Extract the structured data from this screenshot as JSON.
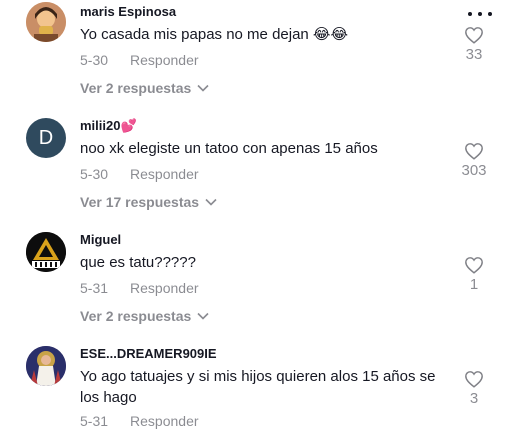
{
  "comments": [
    {
      "username": "maris Espinosa",
      "text": "Yo casada mis papas no me dejan 😂😂",
      "date": "5-30",
      "reply_label": "Responder",
      "likes": "33",
      "view_replies": "Ver 2 respuestas"
    },
    {
      "username": "milii20",
      "username_emoji": "💕",
      "avatar_letter": "D",
      "text": "noo xk elegiste un tatoo con apenas 15 años",
      "date": "5-30",
      "reply_label": "Responder",
      "likes": "303",
      "view_replies": "Ver 17 respuestas"
    },
    {
      "username": "Miguel",
      "text": "que es tatu?????",
      "date": "5-31",
      "reply_label": "Responder",
      "likes": "1",
      "view_replies": "Ver 2 respuestas"
    },
    {
      "username": "ESE...DREAMER909IE",
      "text": "Yo ago tatuajes y si mis hijos quieren alos 15 años se los hago",
      "date": "5-31",
      "reply_label": "Responder",
      "likes": "3"
    }
  ],
  "colors": {
    "text": "#161823",
    "muted": "rgba(22,24,35,0.5)",
    "avatar_letter_bg": "#2f4a5e"
  },
  "icons": [
    "more-options-icon",
    "heart-icon",
    "chevron-down-icon"
  ]
}
